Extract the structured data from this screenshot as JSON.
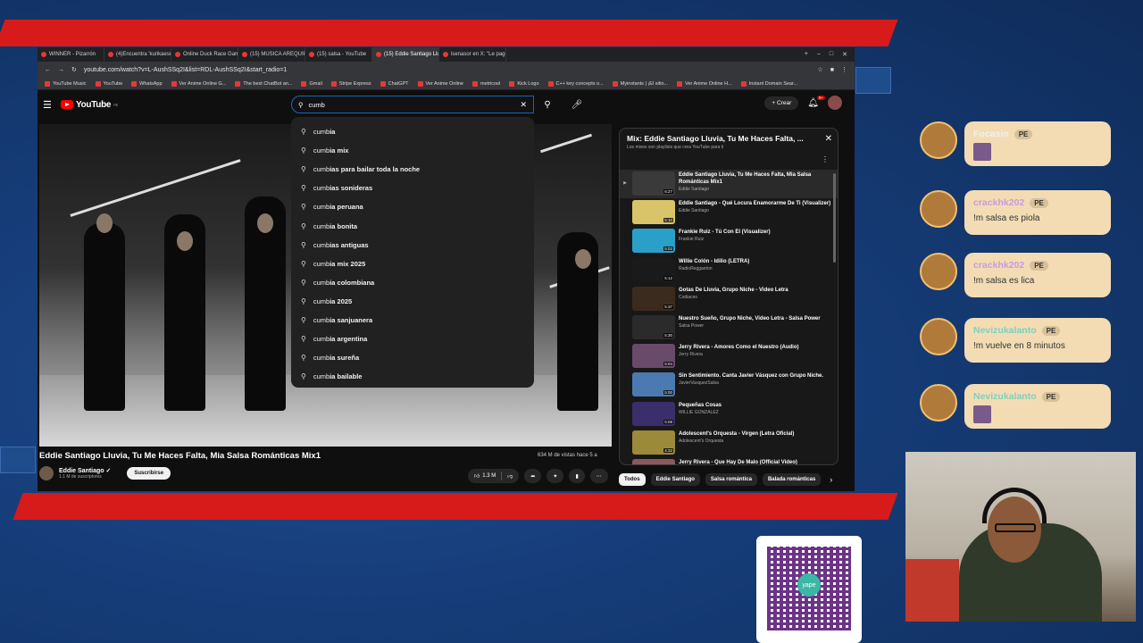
{
  "browser": {
    "tabs": [
      {
        "label": "WINNER - Pizarrón",
        "active": false
      },
      {
        "label": "(4)Encuentra 'kurikaesu trend' en Ti",
        "active": false
      },
      {
        "label": "Online Duck Race Game",
        "active": false
      },
      {
        "label": "(15) MUSICA AREQUIPEÑA: pampe",
        "active": false
      },
      {
        "label": "(15) salsa - YouTube",
        "active": false
      },
      {
        "label": "(15) Eddie Santiago Lluvia, Tu M",
        "active": true
      },
      {
        "label": "lsenasor en X: \"Le pagué medio dó",
        "active": false
      }
    ],
    "url": "youtube.com/watch?v=L-AushSSq2I&list=RDL-AushSSq2I&start_radio=1",
    "bookmarks": [
      "YouTube Music",
      "YouTube",
      "WhatsApp",
      "Ver Anime Online G...",
      "The best ChatBot an...",
      "Gmail",
      "Stripe Express",
      "ChatGPT",
      "Ver Anime Online",
      "metricool",
      "Kick Logo",
      "C++ key concepts o...",
      "Myinstants | ¡El sitio...",
      "Ver Anime Online H...",
      "Instant Domain Sear..."
    ]
  },
  "youtube": {
    "logo_text": "YouTube",
    "logo_region": "PE",
    "search_value": "cumb",
    "create_label": "Crear",
    "notif_count": "9+",
    "suggestions": [
      {
        "prefix": "cumb",
        "rest": "ia"
      },
      {
        "prefix": "cumb",
        "rest": "ia mix"
      },
      {
        "prefix": "cumb",
        "rest": "ias para bailar toda la noche"
      },
      {
        "prefix": "cumb",
        "rest": "ias sonideras"
      },
      {
        "prefix": "cumb",
        "rest": "ia peruana"
      },
      {
        "prefix": "cumb",
        "rest": "ia bonita"
      },
      {
        "prefix": "cumb",
        "rest": "ias antiguas"
      },
      {
        "prefix": "cumb",
        "rest": "ia mix 2025"
      },
      {
        "prefix": "cumb",
        "rest": "ia colombiana"
      },
      {
        "prefix": "cumb",
        "rest": "ia 2025"
      },
      {
        "prefix": "cumb",
        "rest": "ia sanjuanera"
      },
      {
        "prefix": "cumb",
        "rest": "ia argentina"
      },
      {
        "prefix": "cumb",
        "rest": "ia sureña"
      },
      {
        "prefix": "cumb",
        "rest": "ia bailable"
      }
    ],
    "video": {
      "title": "Eddie Santiago Lluvia, Tu Me Haces Falta, Mia Salsa Románticas Mix1",
      "views": "634 M de vistas  hace 5 a",
      "channel": "Eddie Santiago",
      "subscribers": "1.1 M de suscriptores",
      "subscribe_label": "Suscribirse",
      "likes": "1.3 M"
    },
    "mix": {
      "title": "Mix: Eddie Santiago Lluvia, Tu Me Haces Falta, ...",
      "subtitle": "Los mixes son playlists que crea YouTube para ti",
      "items": [
        {
          "title": "Eddie Santiago Lluvia, Tu Me Haces Falta, Mia Salsa Románticas Mix1",
          "channel": "Eddie Santiago",
          "duration": "6:27",
          "active": true,
          "thumb_color": "#3a3a3a"
        },
        {
          "title": "Eddie Santiago - Qué Locura Enamorarme De Ti (Visualizer)",
          "channel": "Eddie Santiago",
          "duration": "5:10",
          "active": false,
          "thumb_color": "#d9c46a"
        },
        {
          "title": "Frankie Ruiz - Tú Con Él (Visualizer)",
          "channel": "Frankie Ruiz",
          "duration": "5:02",
          "active": false,
          "thumb_color": "#2aa0c8"
        },
        {
          "title": "Willie Colón - Idilio (LETRA)",
          "channel": "RadioReggaeton",
          "duration": "5:12",
          "active": false,
          "thumb_color": "#1a1a1a"
        },
        {
          "title": "Gotas De Lluvia, Grupo Niche - Video Letra",
          "channel": "Codiaces",
          "duration": "5:37",
          "active": false,
          "thumb_color": "#3b2b1f"
        },
        {
          "title": "Nuestro Sueño, Grupo Niche, Video Letra - Salsa Power",
          "channel": "Salsa Power",
          "duration": "5:30",
          "active": false,
          "thumb_color": "#2b2b2b"
        },
        {
          "title": "Jerry Rivera - Amores Como el Nuestro (Audio)",
          "channel": "Jerry Rivera",
          "duration": "5:04",
          "active": false,
          "thumb_color": "#6a4a6a"
        },
        {
          "title": "Sin Sentimiento. Canta Javier Vásquez con Grupo Niche.",
          "channel": "JavierVasquezSalsa",
          "duration": "5:00",
          "active": false,
          "thumb_color": "#4a7ab0"
        },
        {
          "title": "Pequeñas Cosas",
          "channel": "WILLIE GONZALEZ",
          "duration": "5:08",
          "active": false,
          "thumb_color": "#3a2f6a"
        },
        {
          "title": "Adolescent's Orquesta - Virgen (Letra Oficial)",
          "channel": "Adolescent's Orquesta",
          "duration": "4:32",
          "active": false,
          "thumb_color": "#9a8a3a"
        },
        {
          "title": "Jerry Rivera - Que Hay De Malo (Official Video)",
          "channel": "",
          "duration": "",
          "active": false,
          "thumb_color": "#8a5a5a"
        }
      ]
    },
    "chips": [
      {
        "label": "Todos",
        "selected": true
      },
      {
        "label": "Eddie Santiago",
        "selected": false
      },
      {
        "label": "Salsa romántica",
        "selected": false
      },
      {
        "label": "Balada románticas",
        "selected": false
      }
    ]
  },
  "chat": [
    {
      "name": "Focasio",
      "badge": "PE",
      "text": "",
      "name_color": "#f0f0f0"
    },
    {
      "name": "crackhk202",
      "badge": "PE",
      "text": "!m salsa es piola",
      "name_color": "#c99ae0"
    },
    {
      "name": "crackhk202",
      "badge": "PE",
      "text": "!m salsa es lica",
      "name_color": "#c99ae0"
    },
    {
      "name": "Nevizukalanto",
      "badge": "PE",
      "text": "!m vuelve en 8 minutos",
      "name_color": "#7ed0c0"
    },
    {
      "name": "Nevizukalanto",
      "badge": "PE",
      "text": "",
      "name_color": "#7ed0c0"
    }
  ],
  "qr": {
    "logo_text": "yape"
  },
  "colors": {
    "accent": "#d71a1a",
    "bg": "#14356b",
    "yt_red": "#ff0000"
  }
}
